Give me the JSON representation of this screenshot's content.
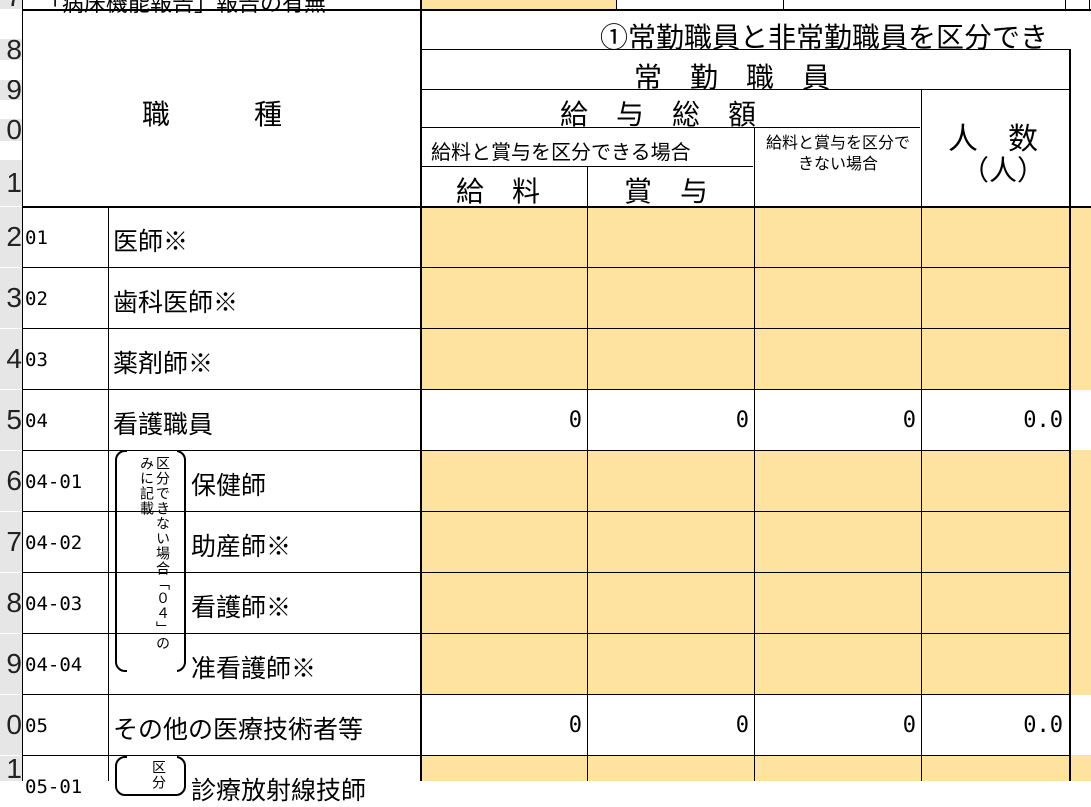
{
  "row_numbers": [
    "7",
    "8",
    "9",
    "0",
    "1",
    "2",
    "3",
    "4",
    "5",
    "6",
    "7",
    "8",
    "9",
    "0",
    "1"
  ],
  "top_cut_text": "「病床機能報告」報告の有無",
  "header": {
    "section_title": "①常勤職員と非常勤職員を区分でき",
    "shokushu": "職　　　種",
    "joukin": "常　勤　職　員",
    "kyuyo_sougaku": "給　与　総　額",
    "kubun_dekiru": "給料と賞与を区分できる場合",
    "kyuryo": "給　料",
    "shoyo": "賞　与",
    "kubun_dekinai": "給料と賞与を区分できない場合",
    "ninzu": "人　数",
    "ninzu_unit": "（人）"
  },
  "bracket_note": "区分できない場合「０４」のみに記載",
  "bracket_note_2": "区分",
  "rows": [
    {
      "code": "01",
      "name": "医師※",
      "values": [
        "",
        "",
        "",
        ""
      ]
    },
    {
      "code": "02",
      "name": "歯科医師※",
      "values": [
        "",
        "",
        "",
        ""
      ]
    },
    {
      "code": "03",
      "name": "薬剤師※",
      "values": [
        "",
        "",
        "",
        ""
      ]
    },
    {
      "code": "04",
      "name": "看護職員",
      "values": [
        "0",
        "0",
        "0",
        "0.0"
      ]
    },
    {
      "code": "04-01",
      "name": "保健師",
      "values": [
        "",
        "",
        "",
        ""
      ]
    },
    {
      "code": "04-02",
      "name": "助産師※",
      "values": [
        "",
        "",
        "",
        ""
      ]
    },
    {
      "code": "04-03",
      "name": "看護師※",
      "values": [
        "",
        "",
        "",
        ""
      ]
    },
    {
      "code": "04-04",
      "name": "准看護師※",
      "values": [
        "",
        "",
        "",
        ""
      ]
    },
    {
      "code": "05",
      "name": "その他の医療技術者等",
      "values": [
        "0",
        "0",
        "0",
        "0.0"
      ]
    },
    {
      "code": "05-01",
      "name": "診療放射線技師",
      "values": [
        "",
        "",
        "",
        ""
      ]
    }
  ],
  "colors": {
    "input_fill": "#fde2a0",
    "row_header": "#e6e6e6",
    "grid": "#000000"
  }
}
